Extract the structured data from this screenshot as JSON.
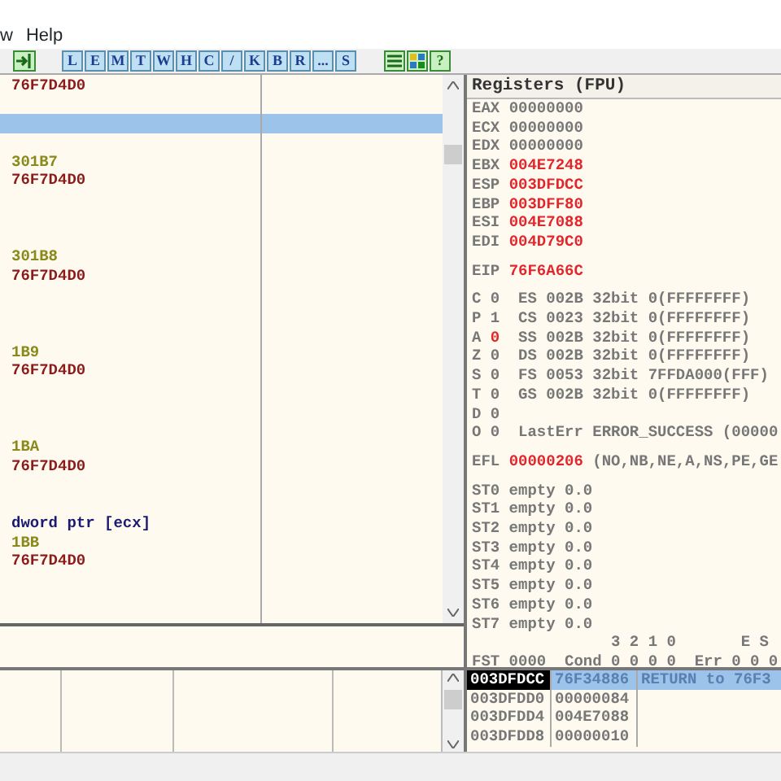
{
  "menu": [
    "w",
    "Help"
  ],
  "toolbar": {
    "letter_buttons": [
      "L",
      "E",
      "M",
      "T",
      "W",
      "H",
      "C",
      "/",
      "K",
      "B",
      "R",
      "...",
      "S"
    ],
    "help_button": "?"
  },
  "disassembly": {
    "rows": [
      {
        "kind": "address",
        "text": "76F7D4D0",
        "selected": false
      },
      {
        "kind": "blank",
        "selected": false
      },
      {
        "kind": "blank",
        "selected": true
      },
      {
        "kind": "blank",
        "selected": false
      },
      {
        "kind": "number",
        "text": "301B7",
        "selected": false
      },
      {
        "kind": "address",
        "text": "76F7D4D0",
        "selected": false
      },
      {
        "kind": "blank",
        "selected": false
      },
      {
        "kind": "blank",
        "selected": false
      },
      {
        "kind": "blank",
        "selected": false
      },
      {
        "kind": "number",
        "text": "301B8",
        "selected": false
      },
      {
        "kind": "address",
        "text": "76F7D4D0",
        "selected": false
      },
      {
        "kind": "blank",
        "selected": false
      },
      {
        "kind": "blank",
        "selected": false
      },
      {
        "kind": "blank",
        "selected": false
      },
      {
        "kind": "number",
        "text": "1B9",
        "selected": false
      },
      {
        "kind": "address",
        "text": "76F7D4D0",
        "selected": false
      },
      {
        "kind": "blank",
        "selected": false
      },
      {
        "kind": "blank",
        "selected": false
      },
      {
        "kind": "blank",
        "selected": false
      },
      {
        "kind": "number",
        "text": "1BA",
        "selected": false
      },
      {
        "kind": "address",
        "text": "76F7D4D0",
        "selected": false
      },
      {
        "kind": "blank",
        "selected": false
      },
      {
        "kind": "blank",
        "selected": false
      },
      {
        "kind": "operand",
        "text": "dword ptr [ecx]",
        "selected": false
      },
      {
        "kind": "number",
        "text": "1BB",
        "selected": false
      },
      {
        "kind": "address",
        "text": "76F7D4D0",
        "selected": false
      }
    ]
  },
  "registers": {
    "title": "Registers (FPU)",
    "general": [
      {
        "name": "EAX",
        "value": "00000000",
        "changed": false
      },
      {
        "name": "ECX",
        "value": "00000000",
        "changed": false
      },
      {
        "name": "EDX",
        "value": "00000000",
        "changed": false
      },
      {
        "name": "EBX",
        "value": "004E7248",
        "changed": true
      },
      {
        "name": "ESP",
        "value": "003DFDCC",
        "changed": true
      },
      {
        "name": "EBP",
        "value": "003DFF80",
        "changed": true
      },
      {
        "name": "ESI",
        "value": "004E7088",
        "changed": true
      },
      {
        "name": "EDI",
        "value": "004D79C0",
        "changed": true
      }
    ],
    "eip": {
      "name": "EIP",
      "value": "76F6A66C",
      "changed": true
    },
    "flags": [
      {
        "flag": "C",
        "value": "0",
        "changed": false,
        "detail": "ES 002B 32bit 0(FFFFFFFF)"
      },
      {
        "flag": "P",
        "value": "1",
        "changed": false,
        "detail": "CS 0023 32bit 0(FFFFFFFF)"
      },
      {
        "flag": "A",
        "value": "0",
        "changed": true,
        "detail": "SS 002B 32bit 0(FFFFFFFF)"
      },
      {
        "flag": "Z",
        "value": "0",
        "changed": false,
        "detail": "DS 002B 32bit 0(FFFFFFFF)"
      },
      {
        "flag": "S",
        "value": "0",
        "changed": false,
        "detail": "FS 0053 32bit 7FFDA000(FFF)"
      },
      {
        "flag": "T",
        "value": "0",
        "changed": false,
        "detail": "GS 002B 32bit 0(FFFFFFFF)"
      },
      {
        "flag": "D",
        "value": "0",
        "changed": false
      },
      {
        "flag": "O",
        "value": "0",
        "changed": false,
        "detail": "LastErr ERROR_SUCCESS (00000"
      }
    ],
    "efl": {
      "name": "EFL",
      "value": "00000206",
      "changed": true,
      "decoded": "(NO,NB,NE,A,NS,PE,GE"
    },
    "fpu": [
      {
        "name": "ST0",
        "tag": "empty",
        "value": "0.0"
      },
      {
        "name": "ST1",
        "tag": "empty",
        "value": "0.0"
      },
      {
        "name": "ST2",
        "tag": "empty",
        "value": "0.0"
      },
      {
        "name": "ST3",
        "tag": "empty",
        "value": "0.0"
      },
      {
        "name": "ST4",
        "tag": "empty",
        "value": "0.0"
      },
      {
        "name": "ST5",
        "tag": "empty",
        "value": "0.0"
      },
      {
        "name": "ST6",
        "tag": "empty",
        "value": "0.0"
      },
      {
        "name": "ST7",
        "tag": "empty",
        "value": "0.0"
      }
    ],
    "fpu_header": "               3 2 1 0       E S",
    "fst": "FST 0000  Cond 0 0 0 0  Err 0 0 0"
  },
  "stack": {
    "rows": [
      {
        "address": "003DFDCC",
        "value": "76F34886",
        "comment": "RETURN to 76F3",
        "selected": true
      },
      {
        "address": "003DFDD0",
        "value": "00000084",
        "selected": false
      },
      {
        "address": "003DFDD4",
        "value": "004E7088",
        "selected": false
      },
      {
        "address": "003DFDD8",
        "value": "00000010",
        "selected": false
      }
    ]
  }
}
